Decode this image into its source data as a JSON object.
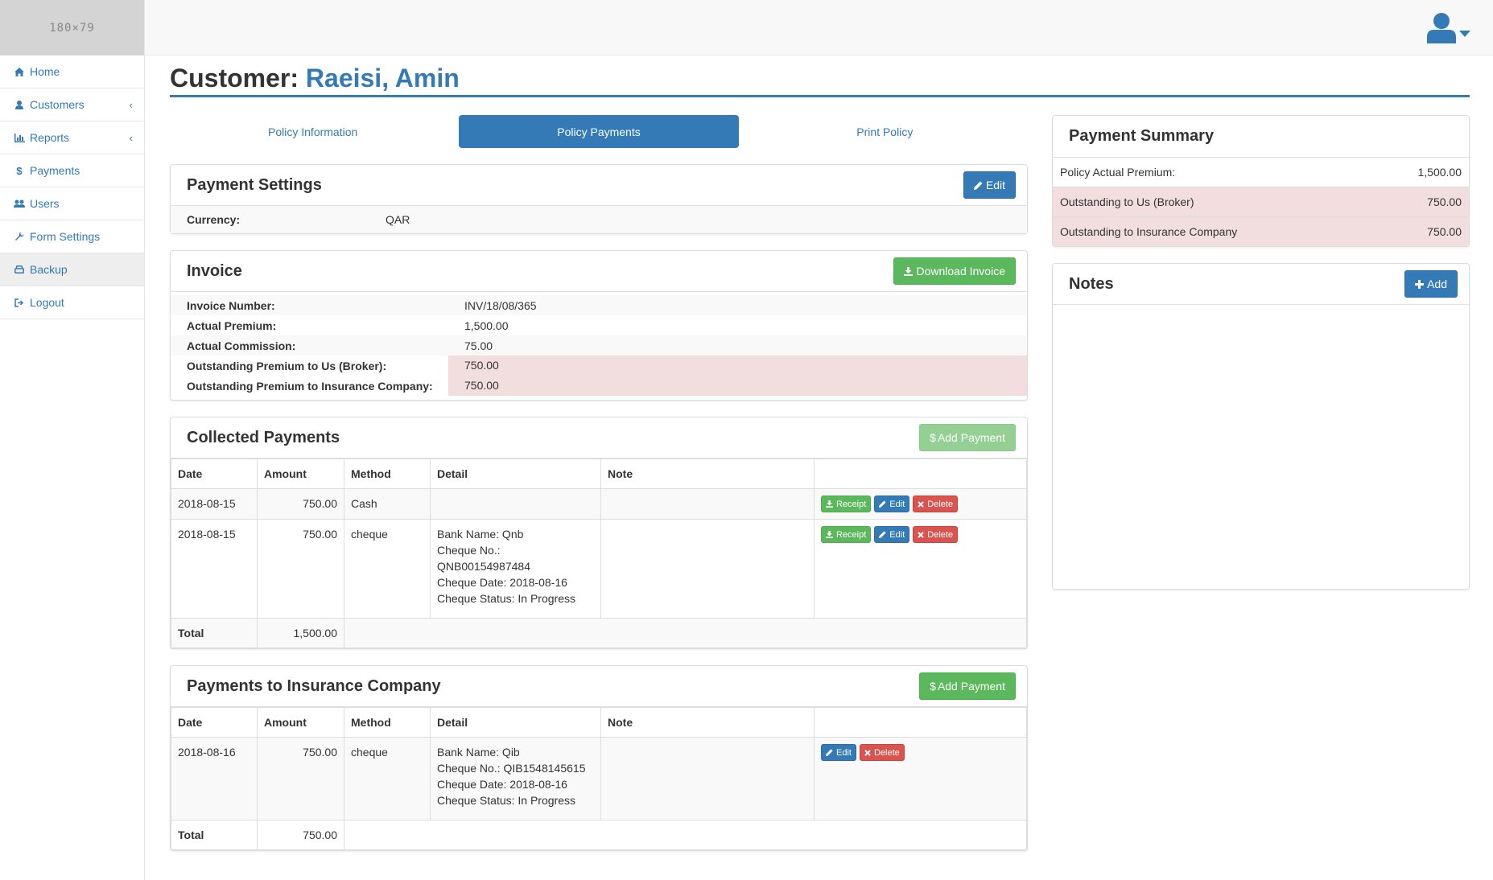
{
  "sidebar": {
    "logo": "180×79",
    "items": [
      {
        "label": "Home",
        "icon": "home-icon"
      },
      {
        "label": "Customers",
        "icon": "user-icon"
      },
      {
        "label": "Reports",
        "icon": "bar-chart-icon"
      },
      {
        "label": "Payments",
        "icon": "dollar-icon"
      },
      {
        "label": "Users",
        "icon": "users-icon"
      },
      {
        "label": "Form Settings",
        "icon": "wrench-icon"
      },
      {
        "label": "Backup",
        "icon": "hdd-icon"
      },
      {
        "label": "Logout",
        "icon": "sign-out-icon"
      }
    ]
  },
  "header": {
    "title_prefix": "Customer:",
    "customer_name": "Raeisi, Amin"
  },
  "tabs": [
    {
      "label": "Policy Information"
    },
    {
      "label": "Policy Payments"
    },
    {
      "label": "Print Policy"
    }
  ],
  "payment_settings": {
    "title": "Payment Settings",
    "edit_label": "Edit",
    "currency_label": "Currency:",
    "currency_value": "QAR"
  },
  "invoice": {
    "title": "Invoice",
    "download_label": "Download Invoice",
    "rows": [
      {
        "label": "Invoice Number:",
        "value": "INV/18/08/365"
      },
      {
        "label": "Actual Premium:",
        "value": "1,500.00"
      },
      {
        "label": "Actual Commission:",
        "value": "75.00"
      },
      {
        "label": "Outstanding Premium to Us (Broker):",
        "value": "750.00"
      },
      {
        "label": "Outstanding Premium to Insurance Company:",
        "value": "750.00"
      }
    ]
  },
  "collected": {
    "title": "Collected Payments",
    "add_label": "Add Payment",
    "headers": [
      "Date",
      "Amount",
      "Method",
      "Detail",
      "Note",
      ""
    ],
    "rows": [
      {
        "date": "2018-08-15",
        "amount": "750.00",
        "method": "Cash",
        "detail": [],
        "note": ""
      },
      {
        "date": "2018-08-15",
        "amount": "750.00",
        "method": "cheque",
        "detail": [
          "Bank Name: Qnb",
          "Cheque No.:",
          "QNB00154987484",
          "Cheque Date: 2018-08-16",
          "Cheque Status: In Progress"
        ],
        "note": ""
      }
    ],
    "total_label": "Total",
    "total_value": "1,500.00",
    "receipt_label": "Receipt",
    "edit_label": "Edit",
    "delete_label": "Delete"
  },
  "insurer": {
    "title": "Payments to Insurance Company",
    "add_label": "Add Payment",
    "headers": [
      "Date",
      "Amount",
      "Method",
      "Detail",
      "Note",
      ""
    ],
    "rows": [
      {
        "date": "2018-08-16",
        "amount": "750.00",
        "method": "cheque",
        "detail": [
          "Bank Name: Qib",
          "Cheque No.: QIB1548145615",
          "Cheque Date: 2018-08-16",
          "Cheque Status: In Progress"
        ],
        "note": ""
      }
    ],
    "total_label": "Total",
    "total_value": "750.00",
    "edit_label": "Edit",
    "delete_label": "Delete"
  },
  "summary": {
    "title": "Payment Summary",
    "rows": [
      {
        "label": "Policy Actual Premium:",
        "value": "1,500.00"
      },
      {
        "label": "Outstanding to Us (Broker)",
        "value": "750.00"
      },
      {
        "label": "Outstanding to Insurance Company",
        "value": "750.00"
      }
    ]
  },
  "notes": {
    "title": "Notes",
    "add_label": "Add"
  }
}
